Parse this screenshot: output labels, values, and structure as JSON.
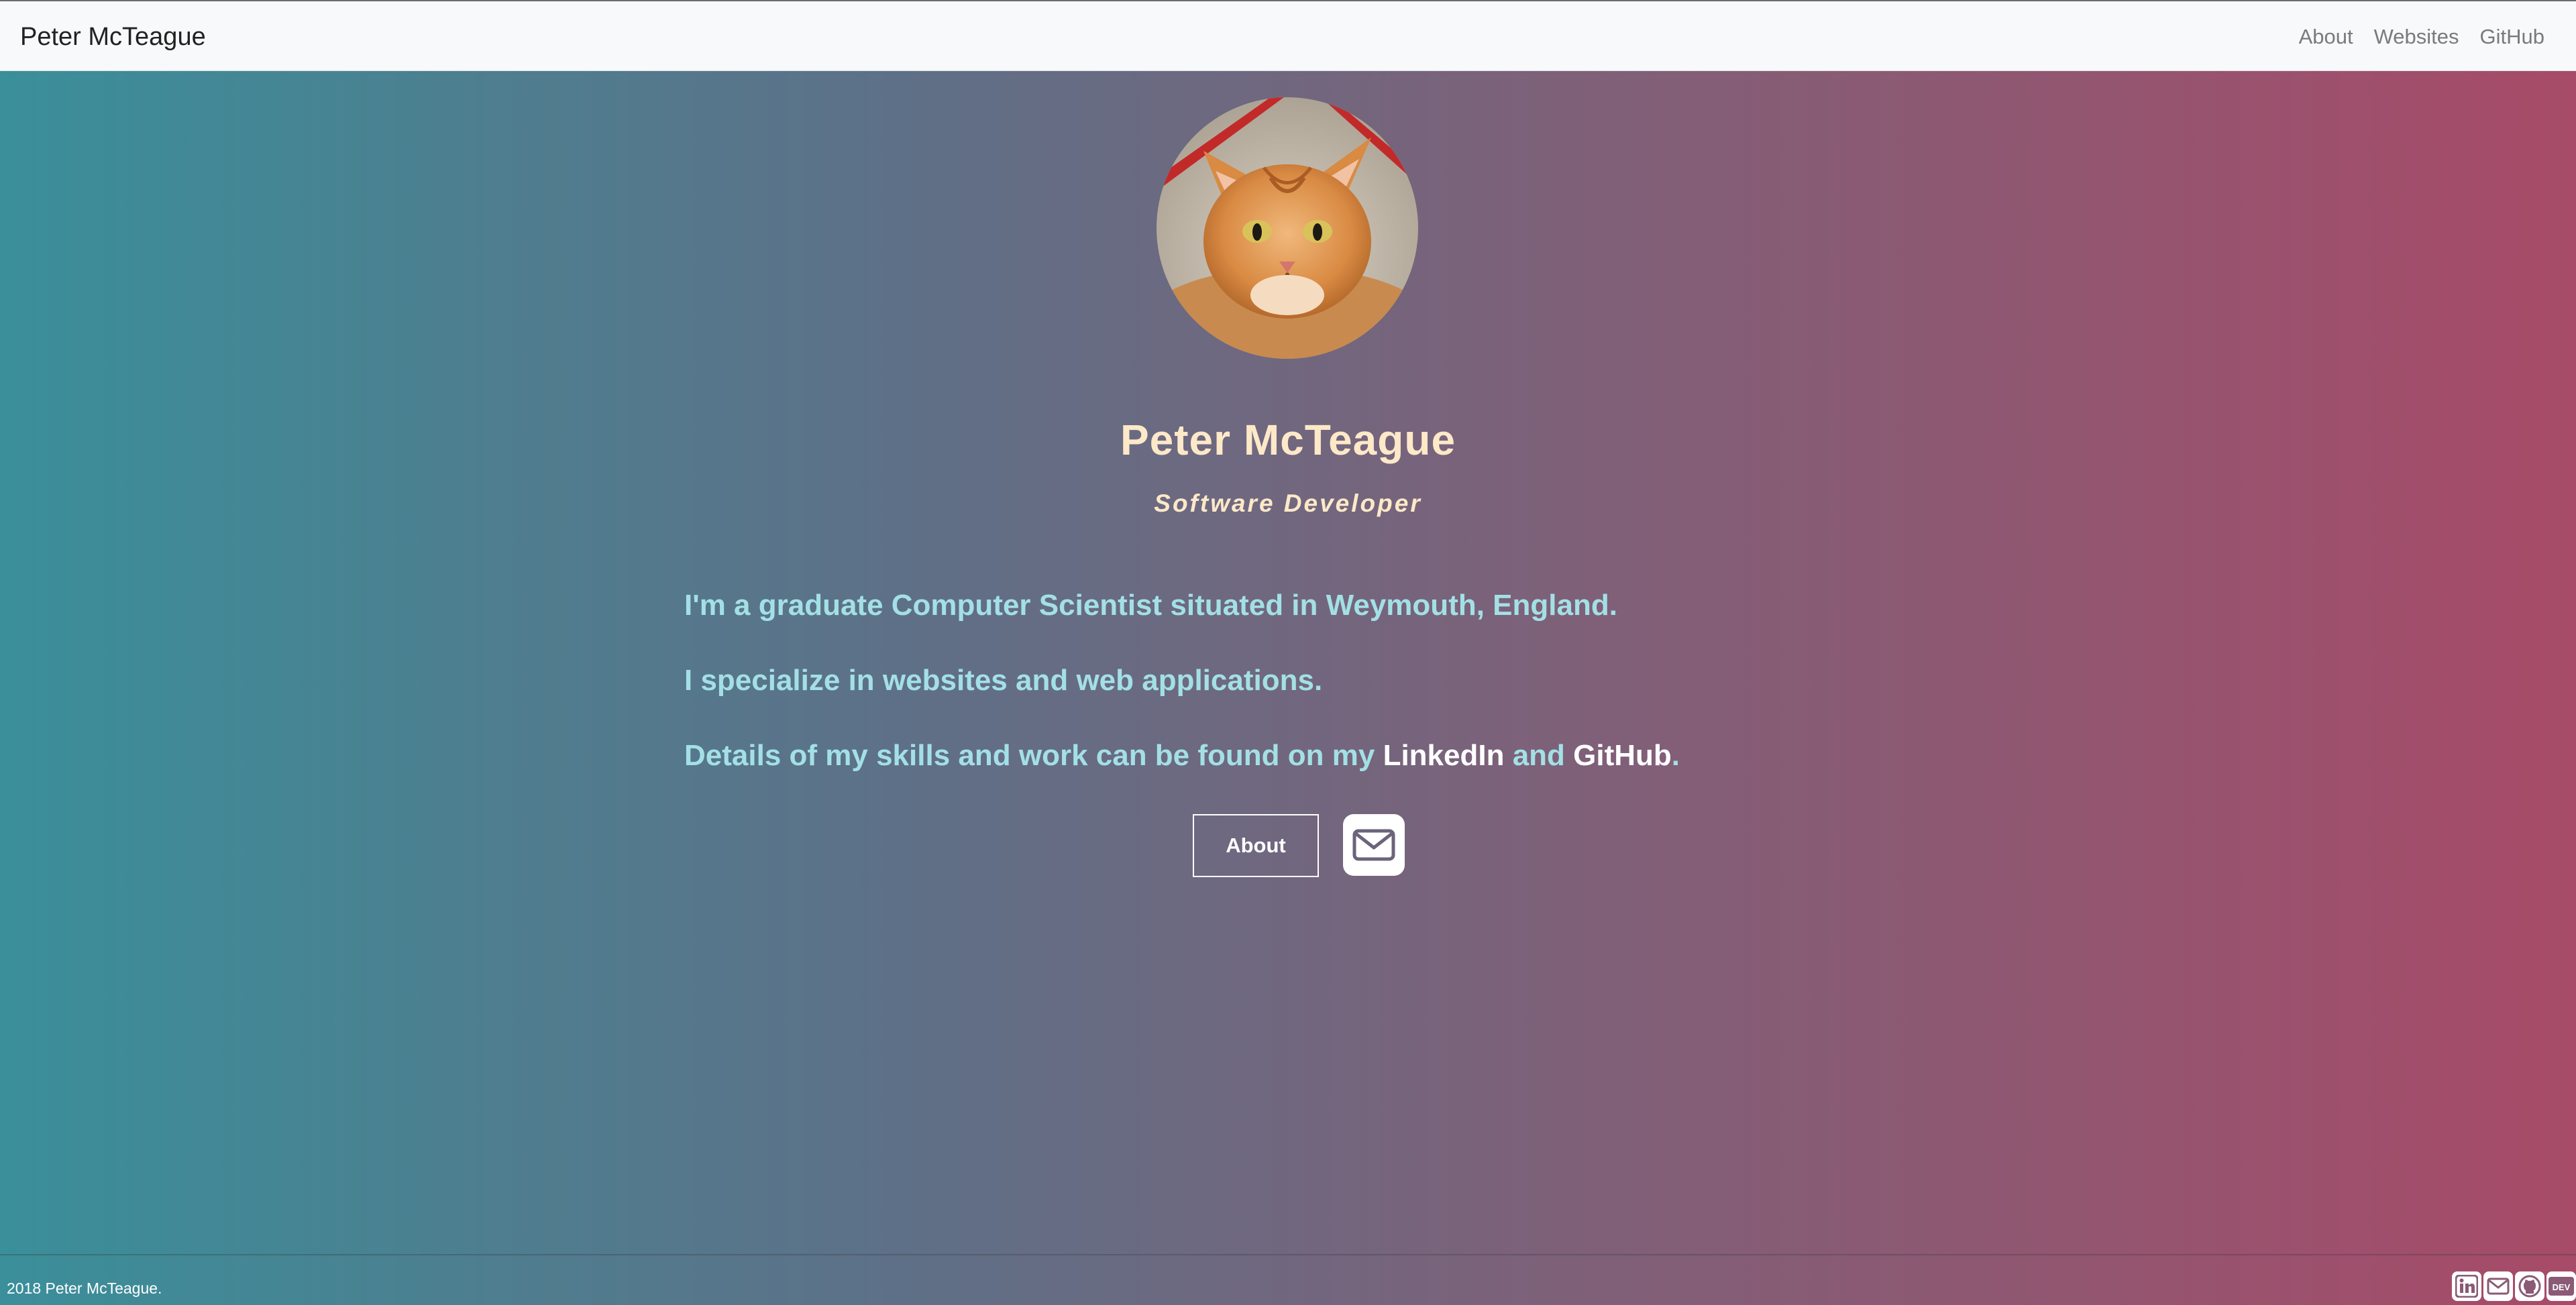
{
  "navbar": {
    "brand": "Peter McTeague",
    "links": [
      {
        "label": "About"
      },
      {
        "label": "Websites"
      },
      {
        "label": "GitHub"
      }
    ]
  },
  "hero": {
    "name": "Peter McTeague",
    "role": "Software Developer",
    "paragraphs": {
      "p1": "I'm a graduate Computer Scientist situated in Weymouth, England.",
      "p2": "I specialize in websites and web applications.",
      "p3_prefix": "Details of my skills and work can be found on my ",
      "p3_link1": "LinkedIn",
      "p3_between": " and ",
      "p3_link2": "GitHub",
      "p3_suffix": "."
    },
    "about_button": "About",
    "email_icon": "envelope-icon"
  },
  "footer": {
    "copyright": "2018 Peter McTeague.",
    "social_icons": [
      "linkedin-icon",
      "email-icon",
      "github-icon",
      "dev-icon"
    ],
    "dev_label": "DEV"
  },
  "colors": {
    "gradient_left": "#3a8f9a",
    "gradient_right": "#a74b68",
    "heading": "#fde8c8",
    "body_text": "#a3e0e6",
    "link": "#ffffff"
  }
}
